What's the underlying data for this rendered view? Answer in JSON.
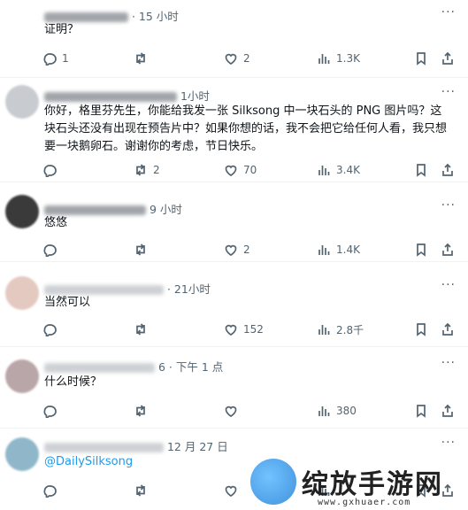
{
  "tweets": [
    {
      "time": "· 15 小时",
      "text": "证明？",
      "replies": "1",
      "retweets": "",
      "likes": "2",
      "views": "1.3K"
    },
    {
      "time": "1小时",
      "text": "你好，格里芬先生，你能给我发一张 Silksong 中一块石头的 PNG 图片吗？这块石头还没有出现在预告片中？如果你想的话，我不会把它给任何人看，我只想要一块鹅卵石。谢谢你的考虑，节日快乐。",
      "replies": "",
      "retweets": "2",
      "likes": "70",
      "views": "3.4K"
    },
    {
      "time": "9 小时",
      "text": "悠悠",
      "replies": "",
      "retweets": "",
      "likes": "2",
      "views": "1.4K"
    },
    {
      "time": "· 21小时",
      "text": "当然可以",
      "replies": "",
      "retweets": "",
      "likes": "152",
      "views": "2.8千"
    },
    {
      "time": "6 · 下午 1 点",
      "text": "什么时候？",
      "replies": "",
      "retweets": "",
      "likes": "",
      "views": "380"
    },
    {
      "time": "12 月 27 日",
      "text": "@DailySilksong",
      "replies": "",
      "retweets": "",
      "likes": "",
      "views": ""
    }
  ],
  "icons": {
    "reply": "reply-icon",
    "retweet": "retweet-icon",
    "like": "heart-icon",
    "views": "views-chart-icon",
    "bookmark": "bookmark-icon",
    "share": "share-icon",
    "more": "more-icon"
  },
  "watermark": {
    "text": "绽放手游网",
    "url": "www.gxhuaer.com"
  },
  "colors": {
    "link": "#1d9bf0",
    "muted": "#536471"
  }
}
